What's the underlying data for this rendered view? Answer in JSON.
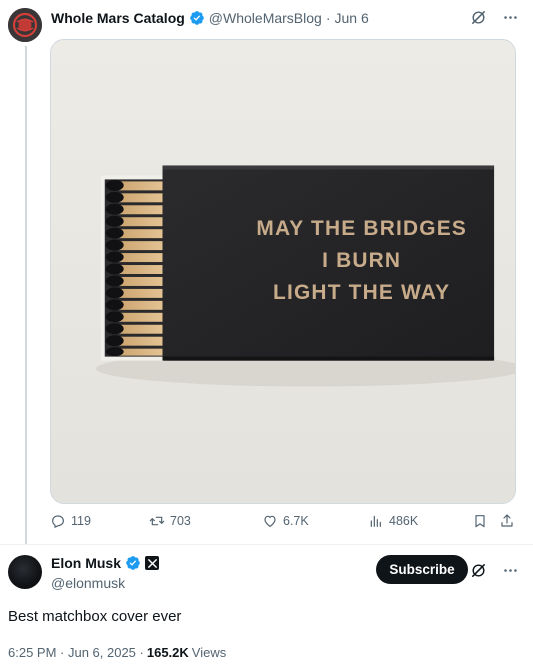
{
  "parent_post": {
    "author_name": "Whole Mars Catalog",
    "handle": "@WholeMarsBlog",
    "separator": "·",
    "date": "Jun 6",
    "image": {
      "text_lines": [
        "MAY THE BRIDGES",
        "I BURN",
        "LIGHT THE WAY"
      ]
    },
    "stats": {
      "replies": "119",
      "reposts": "703",
      "likes": "6.7K",
      "views": "486K"
    }
  },
  "main_post": {
    "author_name": "Elon Musk",
    "handle": "@elonmusk",
    "subscribe_label": "Subscribe",
    "text": "Best matchbox cover ever",
    "timestamp": "6:25 PM · Jun 6, 2025 ·",
    "views_count": "165.2K",
    "views_label": "Views"
  },
  "icons": {
    "verified": "verified-badge-icon",
    "grok": "grok-icon",
    "more": "more-icon",
    "reply": "reply-icon",
    "repost": "repost-icon",
    "like": "heart-icon",
    "views": "views-icon",
    "bookmark": "bookmark-icon",
    "share": "share-icon"
  },
  "colors": {
    "verified_blue": "#1d9bf0",
    "text_primary": "#0f1419",
    "text_secondary": "#536471",
    "border": "#cfd9de",
    "subscribe_bg": "#0f1419"
  }
}
